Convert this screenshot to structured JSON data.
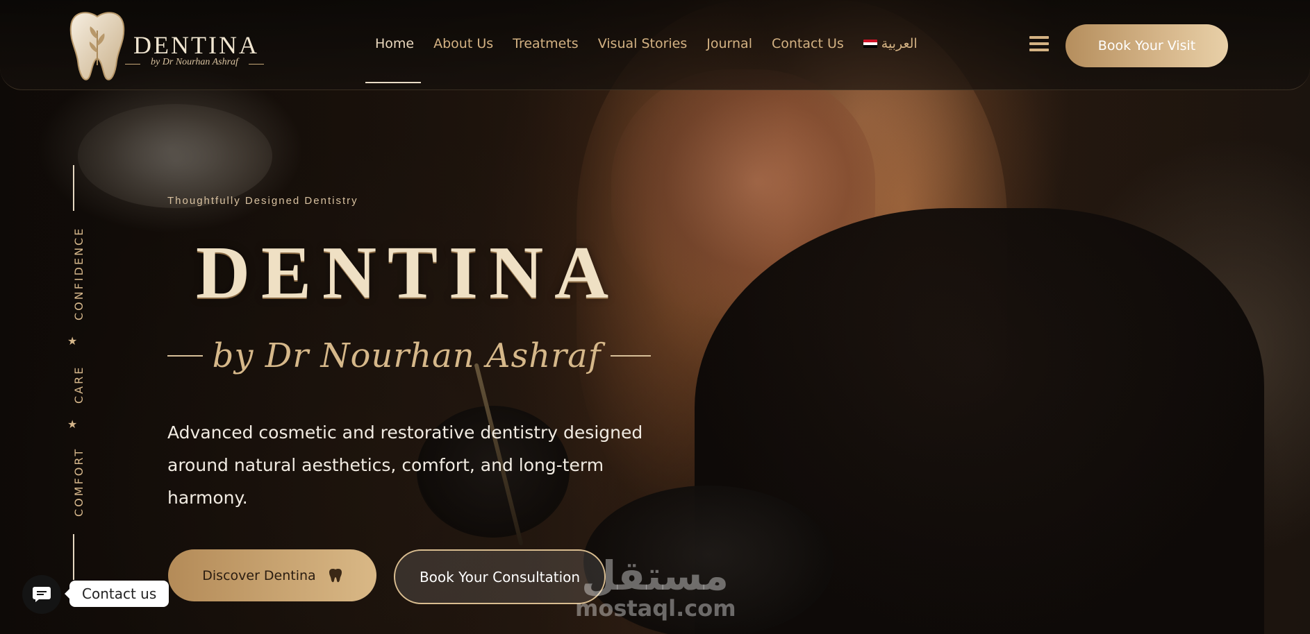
{
  "header": {
    "logo": {
      "word": "DENTINA",
      "sub": "by Dr Nourhan Ashraf"
    },
    "nav": [
      {
        "label": "Home",
        "active": true
      },
      {
        "label": "About Us"
      },
      {
        "label": "Treatmets"
      },
      {
        "label": "Visual Stories"
      },
      {
        "label": "Journal"
      },
      {
        "label": "Contact Us"
      },
      {
        "label": "العربية",
        "icon": "egypt-flag-icon"
      }
    ],
    "menu_icon": "hamburger-icon",
    "cta_label": "Book Your Visit"
  },
  "side": {
    "words": [
      "CONFIDENCE",
      "CARE",
      "COMFORT"
    ],
    "separator_icon": "star-icon"
  },
  "hero": {
    "eyebrow": "Thoughtfully Designed Dentistry",
    "title": "DENTINA",
    "subtitle": "by Dr Nourhan Ashraf",
    "description": "Advanced cosmetic and restorative dentistry designed around natural aesthetics, comfort, and long-term harmony.",
    "primary_button": {
      "label": "Discover Dentina",
      "icon": "tooth-icon"
    },
    "secondary_button": {
      "label": "Book Your Consultation"
    }
  },
  "chat": {
    "label": "Contact us",
    "icon": "chat-bubble-icon"
  },
  "watermark": {
    "arabic": "مستقل",
    "latin": "mostaql.com"
  },
  "colors": {
    "gold": "#d4b283",
    "gold_button": "#c9a572",
    "cream": "#efe0c4",
    "dark": "#0d0906"
  }
}
